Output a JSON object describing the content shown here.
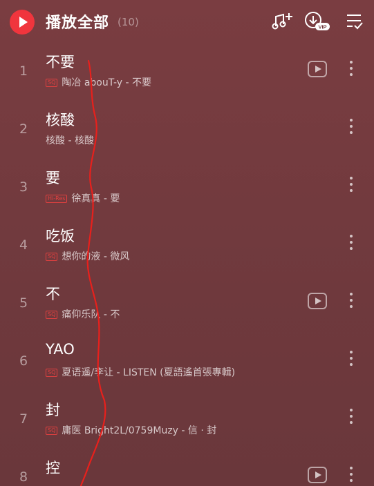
{
  "header": {
    "title": "播放全部",
    "count": "(10)",
    "icons": [
      "play-all-icon",
      "music-note-plus-icon",
      "download-vip-icon",
      "multi-select-list-icon"
    ],
    "vip_label": "VIP"
  },
  "songs": [
    {
      "index": "1",
      "title": "不要",
      "badge": "SQ",
      "subtitle": "陶冶 abouT-y - 不要",
      "has_mv": true
    },
    {
      "index": "2",
      "title": "核酸",
      "badge": "",
      "subtitle": "核酸 - 核酸",
      "has_mv": false
    },
    {
      "index": "3",
      "title": "要",
      "badge": "Hi-Res",
      "subtitle": "徐真真 - 要",
      "has_mv": false
    },
    {
      "index": "4",
      "title": "吃饭",
      "badge": "SQ",
      "subtitle": "想你的液 - 微风",
      "has_mv": false
    },
    {
      "index": "5",
      "title": "不",
      "badge": "SQ",
      "subtitle": "痛仰乐队 - 不",
      "has_mv": true
    },
    {
      "index": "6",
      "title": "YAO",
      "badge": "SQ",
      "subtitle": "夏语遥/李让 - LISTEN (夏語遙首張專輯)",
      "has_mv": false
    },
    {
      "index": "7",
      "title": "封",
      "badge": "SQ",
      "subtitle": "庸医 Bright2L/0759Muzy - 信 · 封",
      "has_mv": false
    },
    {
      "index": "8",
      "title": "控",
      "badge": "",
      "subtitle": "",
      "has_mv": true
    }
  ],
  "colors": {
    "background": "#713a3e",
    "accent": "#f0353d",
    "annotation": "#e8201c"
  }
}
